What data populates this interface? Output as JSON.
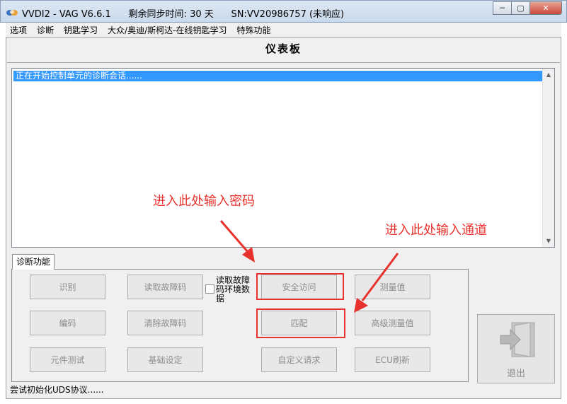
{
  "window": {
    "title": "VVDI2 - VAG V6.6.1      剩余同步时间: 30 天      SN:VV20986757 (未响应)",
    "minimize_label": "─",
    "maximize_label": "▢",
    "close_label": "✕"
  },
  "menu": {
    "items": [
      "选项",
      "诊断",
      "钥匙学习",
      "大众/奥迪/斯柯达-在线钥匙学习",
      "特殊功能"
    ]
  },
  "page": {
    "title": "仪表板"
  },
  "log": {
    "lines": [
      "正在开始控制单元的诊断会话......"
    ],
    "scroll_up": "▲",
    "scroll_down": "▼"
  },
  "tab": {
    "label": "诊断功能"
  },
  "buttons": {
    "identify": "识别",
    "read_dtc": "读取故障码",
    "security_access": "安全访问",
    "measured_values": "测量值",
    "coding": "编码",
    "clear_dtc": "清除故障码",
    "adaptation": "匹配",
    "advanced_measured_values": "高级测量值",
    "component_test": "元件测试",
    "basic_settings": "基础设定",
    "custom_request": "自定义请求",
    "ecu_flash": "ECU刷新",
    "exit": "退出"
  },
  "checkbox": {
    "label": "读取故障码环境数据",
    "checked": false
  },
  "status": {
    "text": "尝试初始化UDS协议......"
  },
  "annotations": {
    "password_hint": "进入此处输入密码",
    "channel_hint": "进入此处输入通道",
    "color": "#e8322d"
  }
}
